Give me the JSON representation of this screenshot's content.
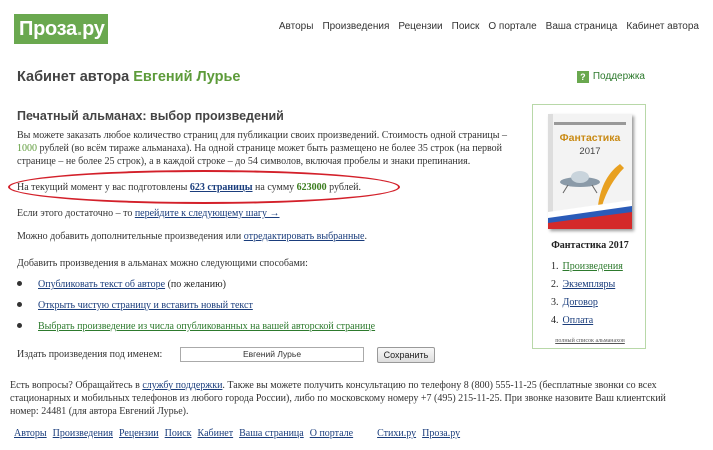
{
  "logo": {
    "text": "Проза",
    "dot": ".",
    "suffix": "ру"
  },
  "topnav": [
    "Авторы",
    "Произведения",
    "Рецензии",
    "Поиск",
    "О портале",
    "Ваша страница",
    "Кабинет автора"
  ],
  "header": {
    "cabinet_label": "Кабинет автора",
    "author_name": "Евгений Лурье",
    "support_icon": "?",
    "support_label": "Поддержка"
  },
  "section_title": "Печатный альманах: выбор произведений",
  "intro": {
    "part1": "Вы можете заказать любое количество страниц для публикации своих произведений. Стоимость одной страницы –",
    "price": "1000",
    "part2": "рублей (во всём тираже альманаха). На одной странице может быть размещено не более 35 строк (на первой странице – не более 25 строк), а в каждой строке – до 54 символов, включая пробелы и знаки препинания."
  },
  "status": {
    "prefix": "На текущий момент у вас подготовлены",
    "pages": "623 страницы",
    "middle": "на сумму",
    "sum": "623000",
    "suffix": "рублей."
  },
  "next_step": {
    "prefix": "Если этого достаточно – то",
    "link": "перейдите к следующему шагу →"
  },
  "add_more": {
    "prefix": "Можно добавить дополнительные произведения или",
    "link": "отредактировать выбранные",
    "suffix": "."
  },
  "methods_label": "Добавить произведения в альманах можно следующими способами:",
  "methods": [
    {
      "link": "Опубликовать текст об авторе",
      "suffix": "(по желанию)"
    },
    {
      "link": "Открыть чистую страницу и вставить новый текст",
      "suffix": ""
    },
    {
      "link": "Выбрать произведение из числа опубликованных на вашей авторской странице",
      "suffix": ""
    }
  ],
  "publish": {
    "label": "Издать произведения под именем:",
    "value": "Евгений Лурье",
    "button": "Сохранить"
  },
  "sidebar": {
    "book_title": "Фантастика",
    "book_year": "2017",
    "title": "Фантастика 2017",
    "steps": [
      {
        "num": "1.",
        "label": "Произведения"
      },
      {
        "num": "2.",
        "label": "Экземпляры"
      },
      {
        "num": "3.",
        "label": "Договор"
      },
      {
        "num": "4.",
        "label": "Оплата"
      }
    ],
    "full_list": "полный список альманахов"
  },
  "contact": {
    "part1": "Есть вопросы? Обращайтесь в",
    "link": "службу поддержки",
    "part2": ". Также вы можете получить консультацию по телефону 8 (800) 555-11-25 (бесплатные звонки со всех стационарных и мобильных телефонов из любого города России), либо по московскому номеру +7 (495) 215-11-25. При звонке назовите Ваш клиентский номер: 24481 (для автора Евгений Лурье)."
  },
  "footer": [
    "Авторы",
    "Произведения",
    "Рецензии",
    "Поиск",
    "Кабинет",
    "Ваша страница",
    "О портале",
    "Стихи.ру",
    "Проза.ру"
  ]
}
